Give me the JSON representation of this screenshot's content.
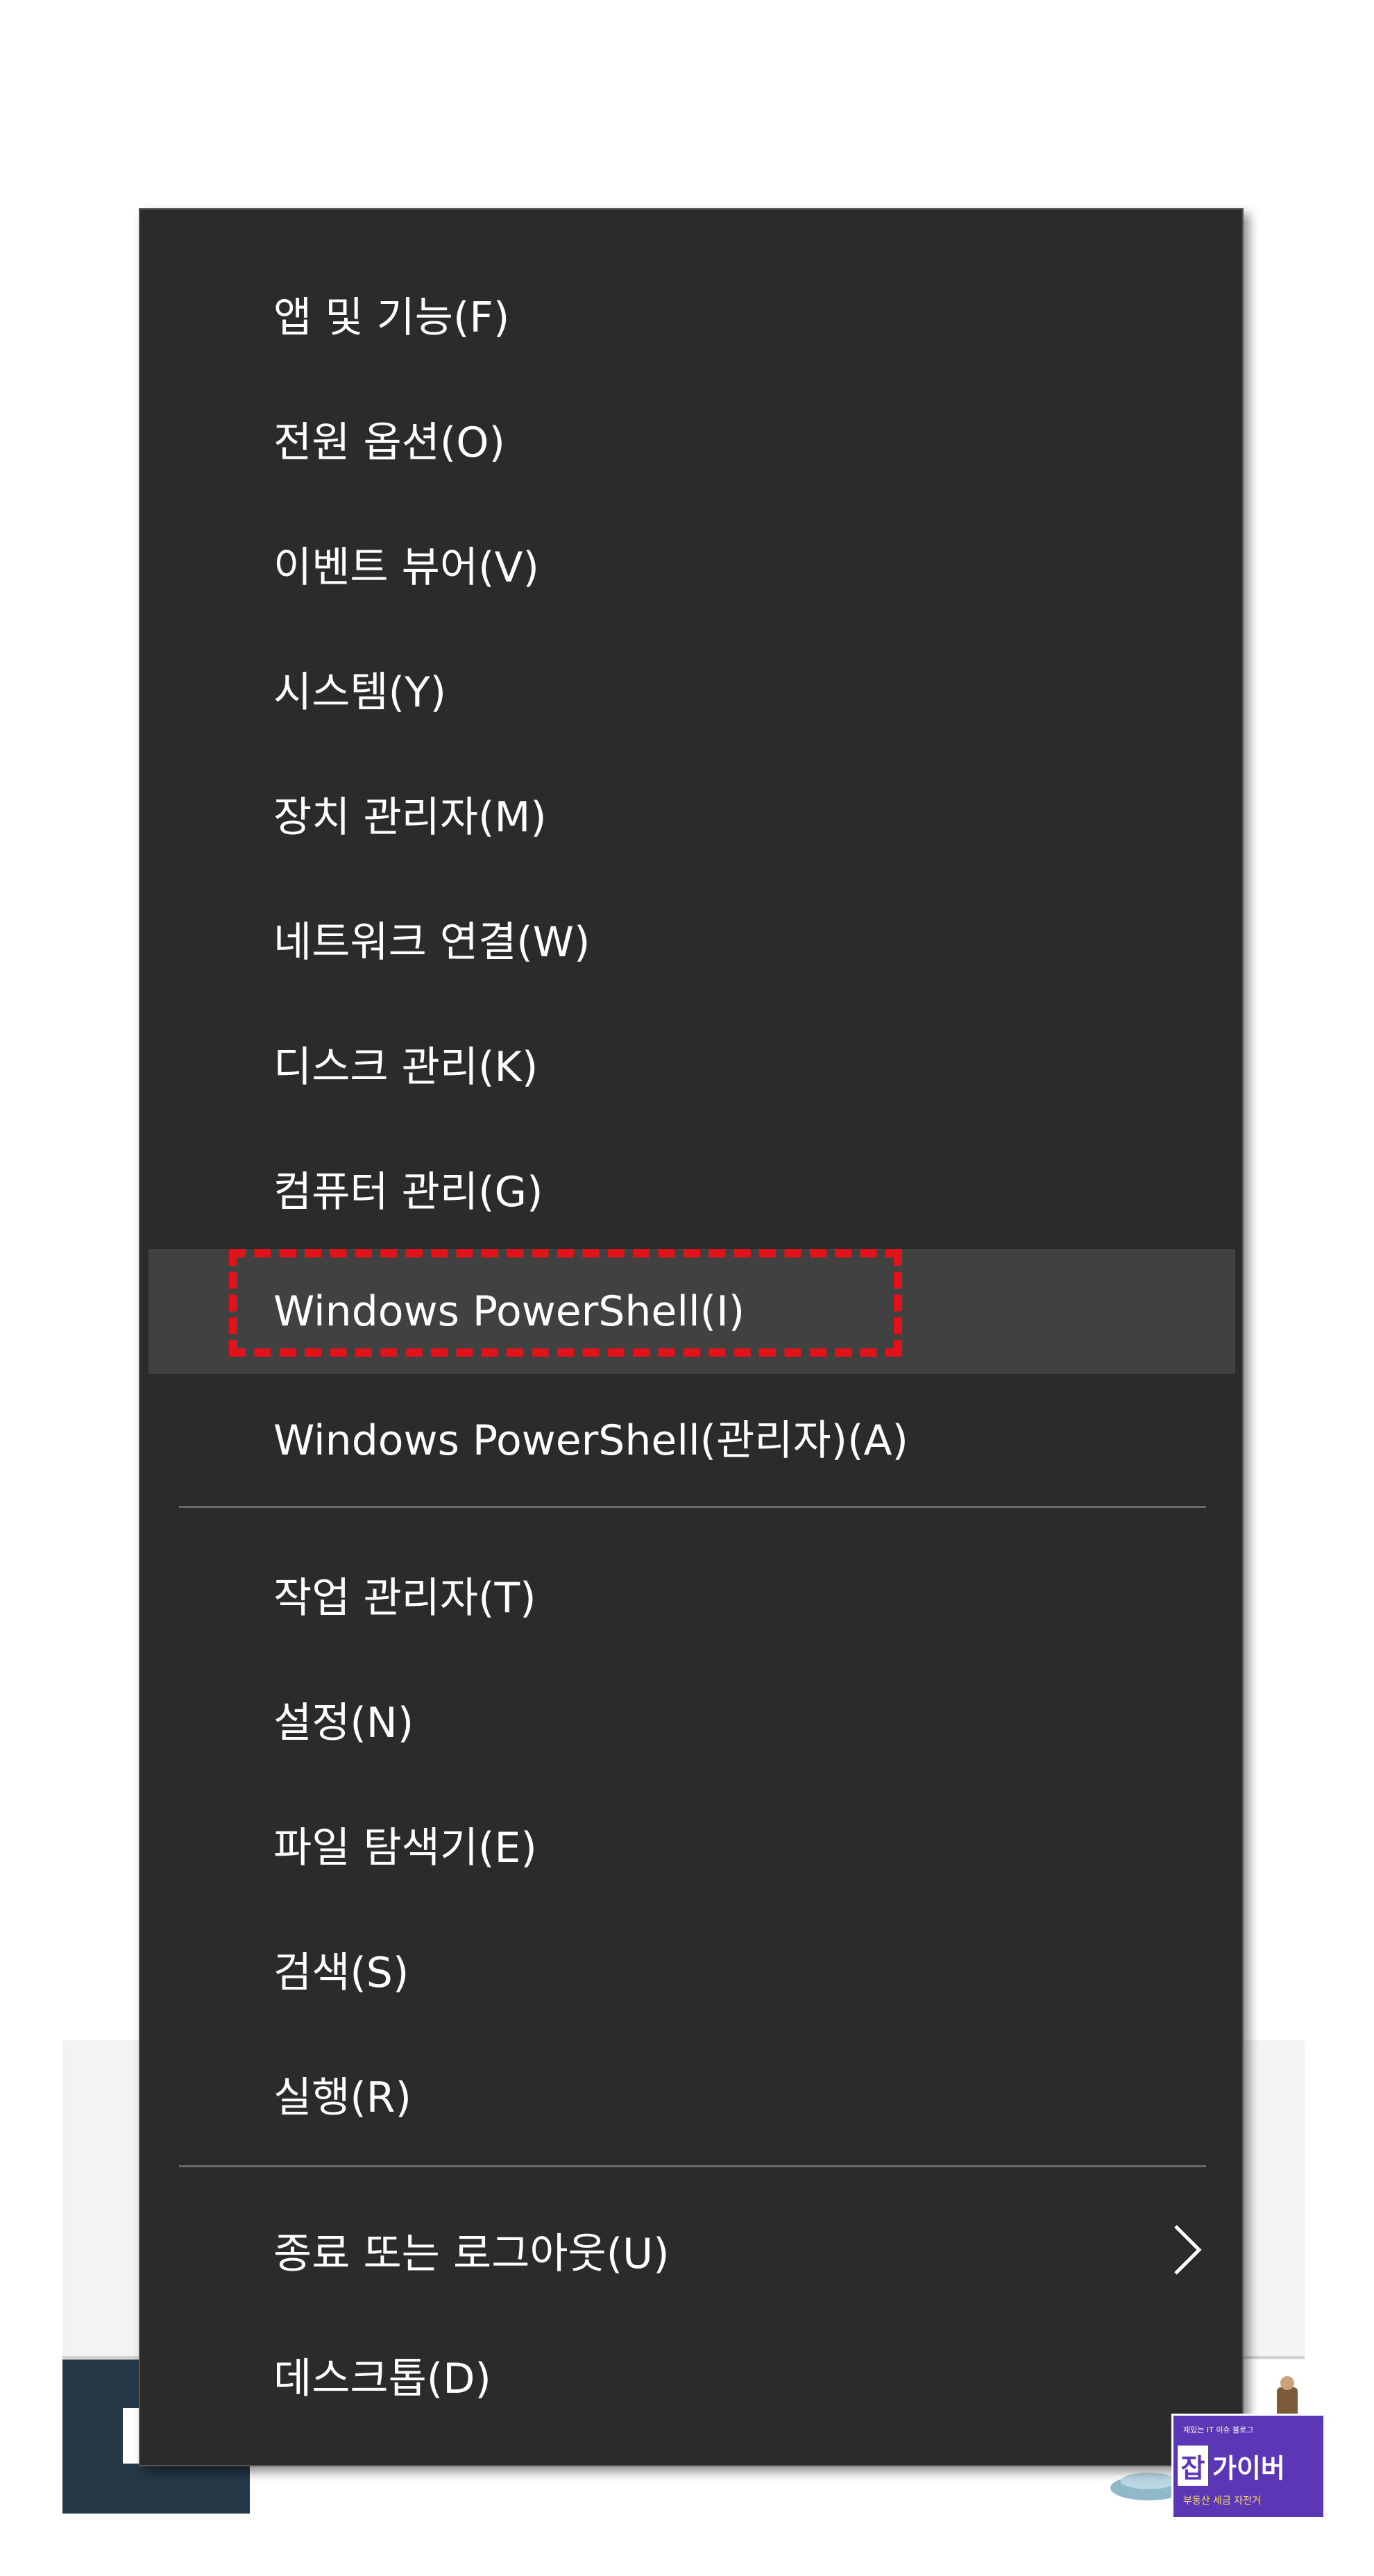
{
  "menu": {
    "items": [
      {
        "label": "앱 및 기능(F)"
      },
      {
        "label": "전원 옵션(O)"
      },
      {
        "label": "이벤트 뷰어(V)"
      },
      {
        "label": "시스템(Y)"
      },
      {
        "label": "장치 관리자(M)"
      },
      {
        "label": "네트워크 연결(W)"
      },
      {
        "label": "디스크 관리(K)"
      },
      {
        "label": "컴퓨터 관리(G)"
      },
      {
        "label": "Windows PowerShell(I)"
      },
      {
        "label": "Windows PowerShell(관리자)(A)"
      },
      {
        "label": "작업 관리자(T)"
      },
      {
        "label": "설정(N)"
      },
      {
        "label": "파일 탐색기(E)"
      },
      {
        "label": "검색(S)"
      },
      {
        "label": "실행(R)"
      },
      {
        "label": "종료 또는 로그아웃(U)"
      },
      {
        "label": "데스크톱(D)"
      }
    ],
    "highlighted_item": "Windows PowerShell(I)",
    "submenu_icon": "chevron-right-icon",
    "colors": {
      "background": "#2b2b2b",
      "highlight": "#414141",
      "text": "#ffffff",
      "focus_outline": "#e0131b"
    }
  },
  "watermark": {
    "top_text": "재밌는 IT 이슈 블로그",
    "square_char": "잡",
    "main_text": "가이버",
    "bottom_text": "부동산 세금 자전거",
    "color": "#5b36b5"
  }
}
